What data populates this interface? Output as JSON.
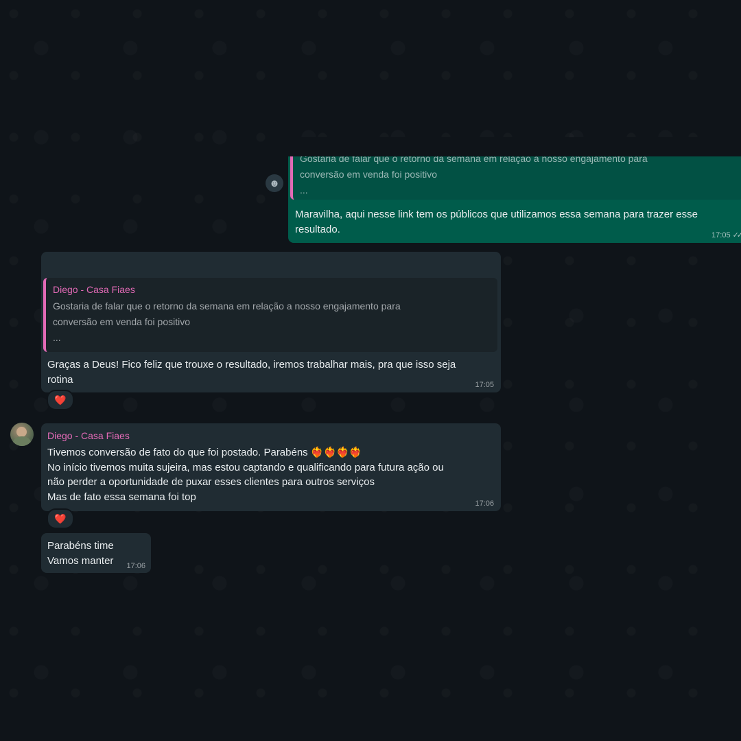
{
  "messages": {
    "m1": {
      "quote_text": "Gostaria de falar que o retorno da semana em relação a nosso engajamento para\nconversão em venda foi positivo\n...",
      "text": "Maravilha, aqui nesse link tem os públicos que utilizamos essa semana para trazer esse\nresultado.",
      "time": "17:05",
      "status_icon": "double-check-icon"
    },
    "m2": {
      "quote_sender": "Diego - Casa Fiaes",
      "quote_text": "Gostaria de falar que o retorno da semana em relação a nosso engajamento para\nconversão em venda foi positivo\n...",
      "text": "Graças a Deus! Fico feliz que trouxe o resultado, iremos trabalhar mais, pra que isso seja\nrotina",
      "time": "17:05",
      "reaction": "❤️"
    },
    "m3": {
      "sender": "Diego - Casa Fiaes",
      "text": "Tivemos conversão de fato do que foi postado. Parabéns ❤️‍🔥❤️‍🔥❤️‍🔥❤️‍🔥\nNo início tivemos muita sujeira, mas estou captando e qualificando para futura ação ou\nnão perder a oportunidade de puxar esses clientes para outros serviços\nMas de fato essa semana foi top",
      "time": "17:06",
      "reaction": "❤️"
    },
    "m4": {
      "text": "Parabéns time\nVamos manter",
      "time": "17:06"
    }
  },
  "icons": {
    "emoji_reaction": "☻"
  },
  "colors": {
    "outgoing_bubble": "#005c4b",
    "incoming_bubble": "#202c33",
    "sender_name": "#e26ab6",
    "background": "#0f1419"
  }
}
